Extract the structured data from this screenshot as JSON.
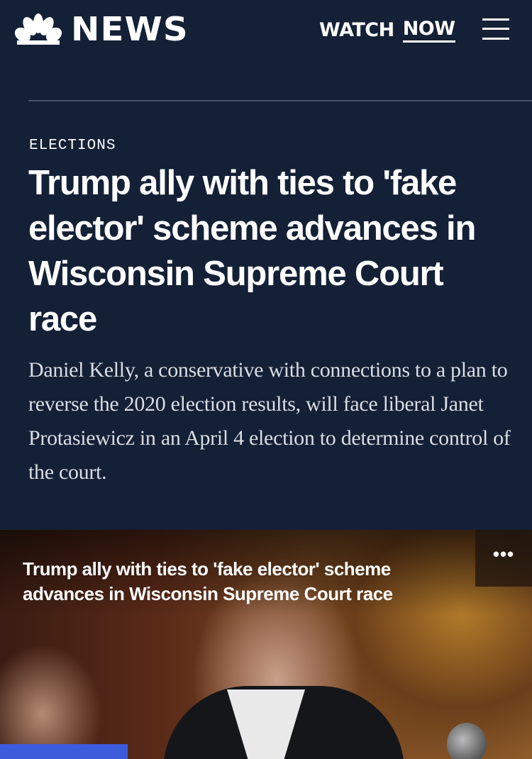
{
  "header": {
    "logo_text": "NEWS",
    "watch_label": "WATCH",
    "now_label": "NOW",
    "menu_icon": "hamburger-icon"
  },
  "article": {
    "category": "ELECTIONS",
    "headline": "Trump ally with ties to 'fake elector' scheme advances in Wisconsin Supreme Court race",
    "dek": "Daniel Kelly, a conservative with connections to a plan to reverse the 2020 election results, will face liberal Janet Protasiewicz in an April 4 election to determine control of the court."
  },
  "video": {
    "title": "Trump ally with ties to 'fake elector' scheme advances in Wisconsin Supreme Court race",
    "more_label": "•••"
  },
  "colors": {
    "background": "#142036",
    "accent": "#3b5bdb"
  }
}
